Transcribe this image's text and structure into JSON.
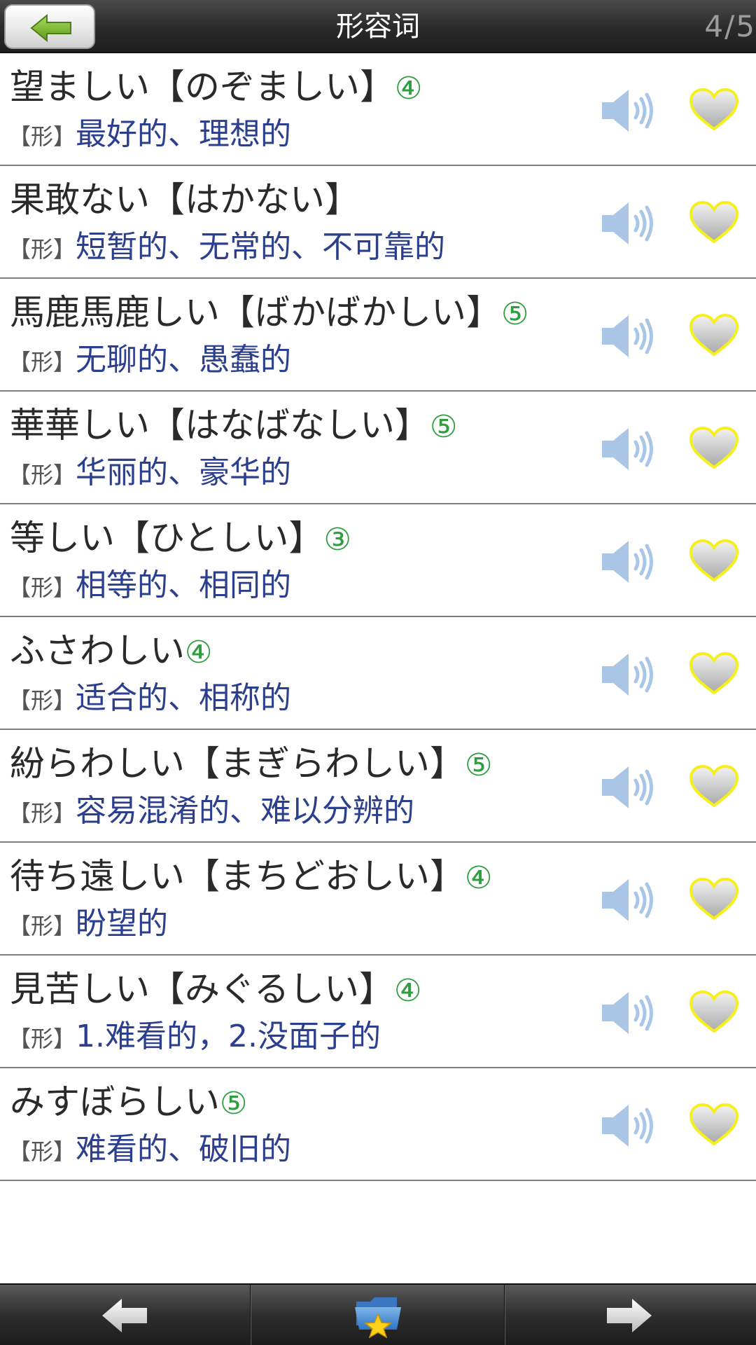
{
  "header": {
    "title": "形容词",
    "page_counter": "4/5",
    "back_icon": "back-arrow-icon"
  },
  "words": [
    {
      "word": "望ましい【のぞましい】",
      "level": "④",
      "pos": "【形】",
      "meaning": "最好的、理想的"
    },
    {
      "word": "果敢ない【はかない】",
      "level": "",
      "pos": "【形】",
      "meaning": "短暂的、无常的、不可靠的"
    },
    {
      "word": "馬鹿馬鹿しい【ばかばかしい】",
      "level": "⑤",
      "pos": "【形】",
      "meaning": "无聊的、愚蠢的"
    },
    {
      "word": "華華しい【はなばなしい】",
      "level": "⑤",
      "pos": "【形】",
      "meaning": "华丽的、豪华的"
    },
    {
      "word": "等しい【ひとしい】",
      "level": "③",
      "pos": "【形】",
      "meaning": "相等的、相同的"
    },
    {
      "word": "ふさわしい",
      "level": "④",
      "pos": "【形】",
      "meaning": "适合的、相称的"
    },
    {
      "word": "紛らわしい【まぎらわしい】",
      "level": "⑤",
      "pos": "【形】",
      "meaning": "容易混淆的、难以分辨的"
    },
    {
      "word": "待ち遠しい【まちどおしい】",
      "level": "④",
      "pos": "【形】",
      "meaning": "盼望的"
    },
    {
      "word": "見苦しい【みぐるしい】",
      "level": "④",
      "pos": "【形】",
      "meaning": "1.难看的，2.没面子的"
    },
    {
      "word": "みすぼらしい",
      "level": "⑤",
      "pos": "【形】",
      "meaning": "难看的、破旧的"
    }
  ],
  "icons": {
    "speaker": "speaker-icon",
    "favorite": "heart-icon",
    "prev": "left-arrow-icon",
    "folder": "star-folder-icon",
    "next": "right-arrow-icon"
  },
  "colors": {
    "level": "#2f9e3e",
    "meaning": "#2b3f8e",
    "speaker": "#a9c6e6",
    "heart_border": "#f5ef1e",
    "back_arrow": "#76b82a"
  }
}
